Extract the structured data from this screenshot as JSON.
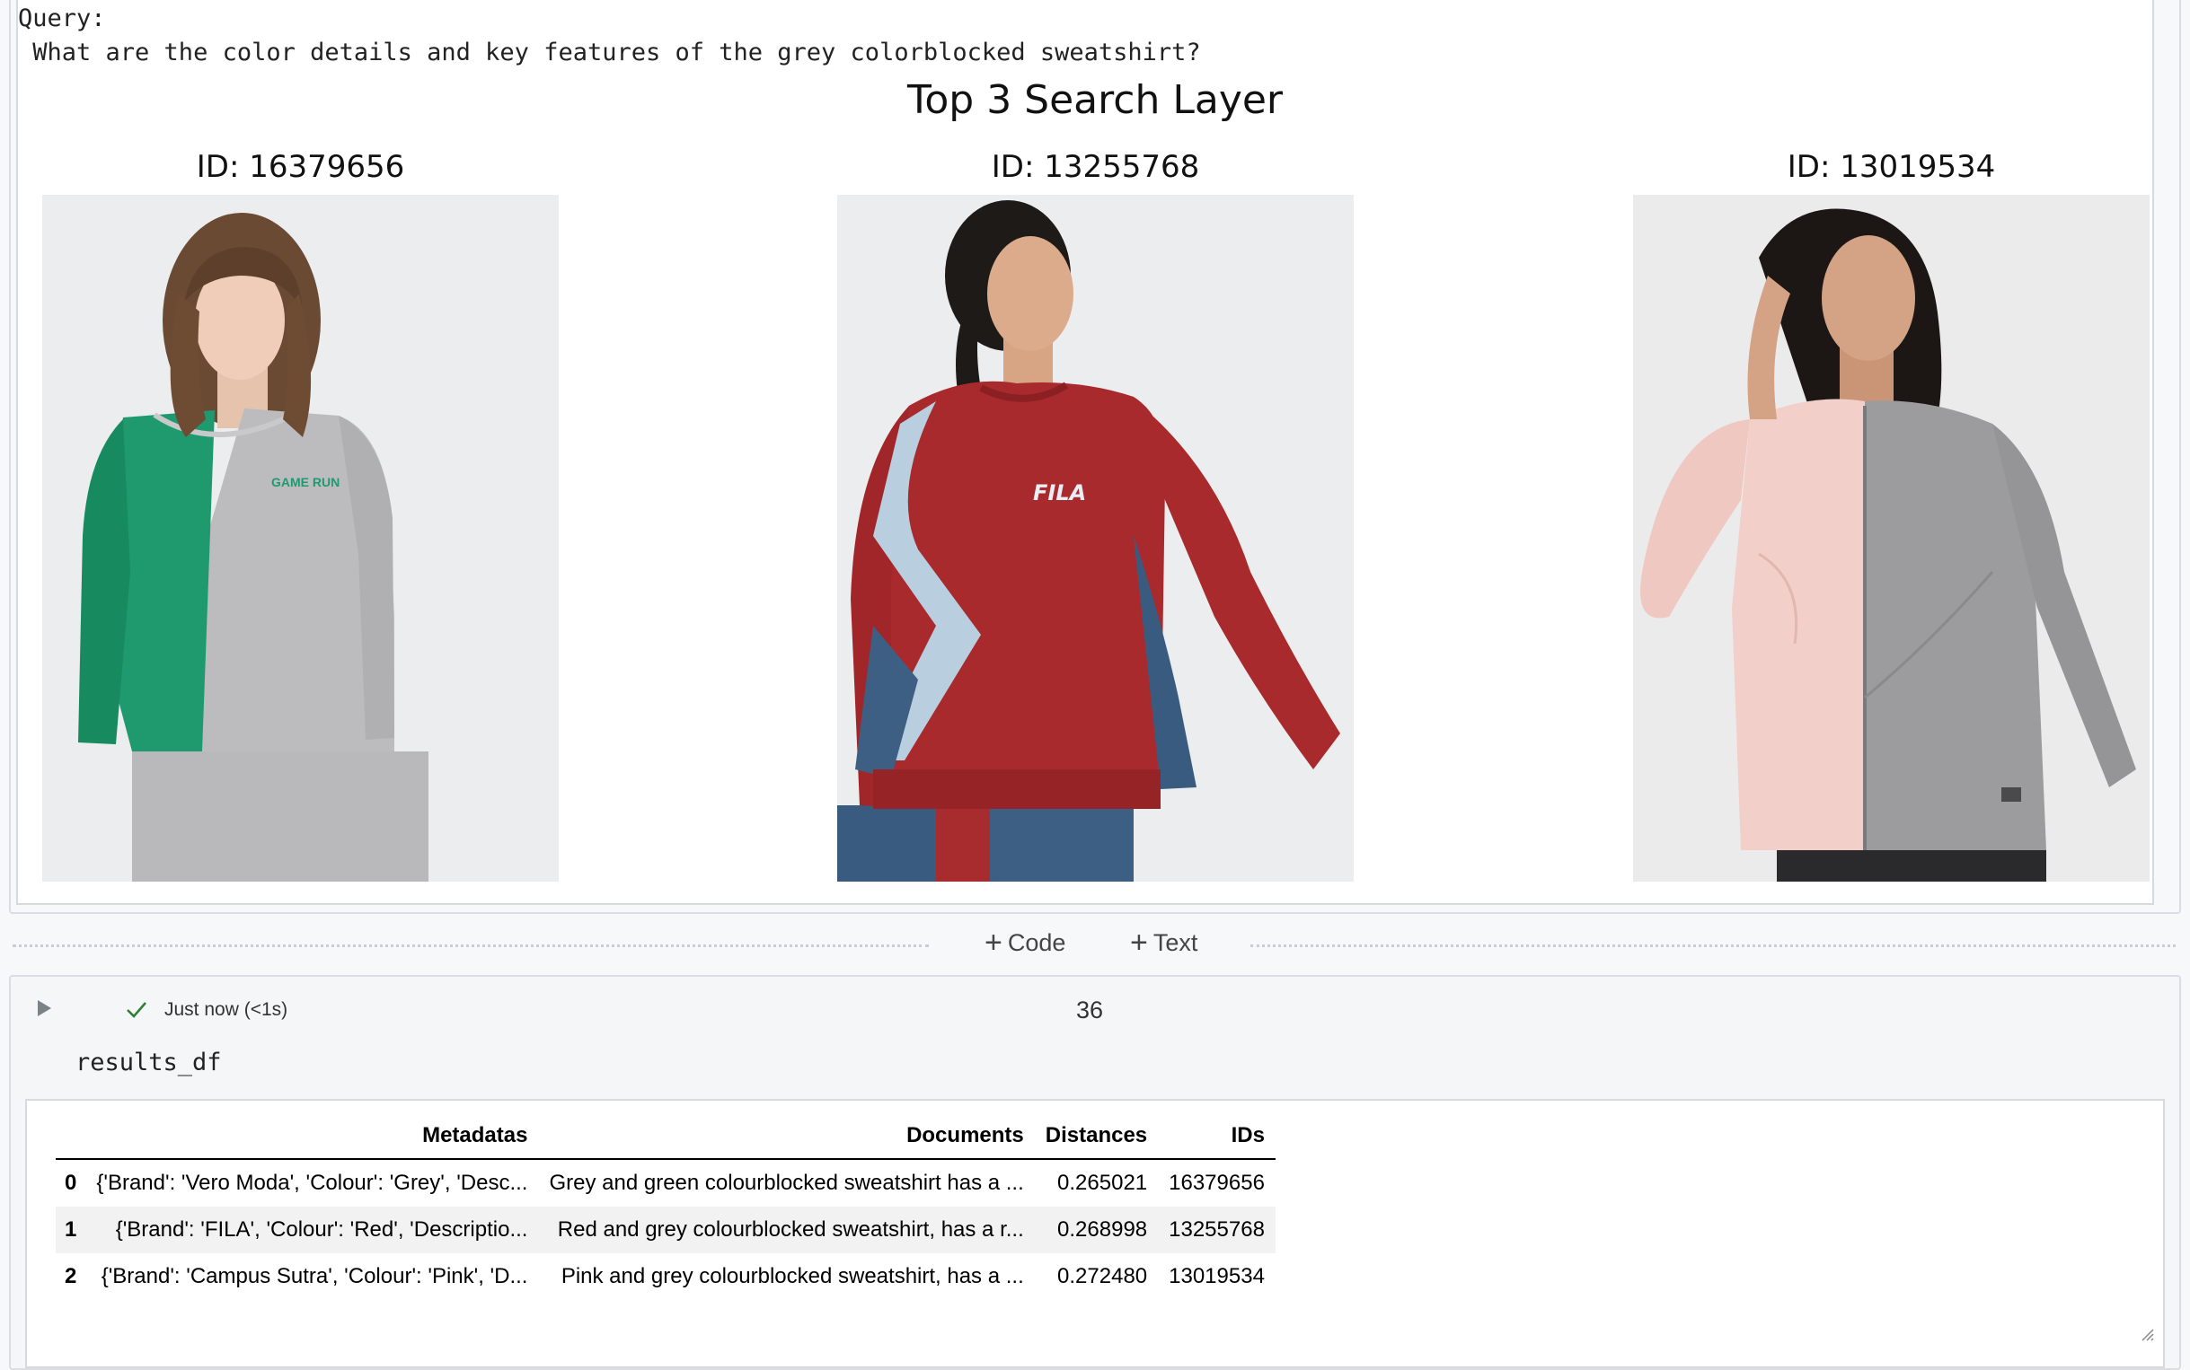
{
  "output": {
    "query_label": "Query:",
    "query_text": " What are the color details and key features of the grey colorblocked sweatshirt?",
    "plot_title": "Top 3 Search Layer",
    "images": [
      {
        "title": "ID: 16379656",
        "desc": "woman in green and grey colourblocked sweatshirt"
      },
      {
        "title": "ID: 13255768",
        "desc": "woman in red FILA colourblocked sweatshirt",
        "logo_text": "FILA"
      },
      {
        "title": "ID: 13019534",
        "desc": "woman in pink and grey colourblocked zip jacket"
      }
    ]
  },
  "add_bar": {
    "code_label": "Code",
    "text_label": "Text"
  },
  "code_cell": {
    "status": "Just now (<1s)",
    "execution_count": "36",
    "code": "results_df"
  },
  "dataframe": {
    "columns": [
      "",
      "Metadatas",
      "Documents",
      "Distances",
      "IDs"
    ],
    "rows": [
      {
        "index": "0",
        "metadatas": "{'Brand': 'Vero Moda', 'Colour': 'Grey', 'Desc...",
        "documents": "Grey and green colourblocked sweatshirt has a ...",
        "distances": "0.265021",
        "ids": "16379656"
      },
      {
        "index": "1",
        "metadatas": "{'Brand': 'FILA', 'Colour': 'Red', 'Descriptio...",
        "documents": "Red and grey colourblocked sweatshirt, has a r...",
        "distances": "0.268998",
        "ids": "13255768"
      },
      {
        "index": "2",
        "metadatas": "{'Brand': 'Campus Sutra', 'Colour': 'Pink', 'D...",
        "documents": "Pink and grey colourblocked sweatshirt, has a ...",
        "distances": "0.272480",
        "ids": "13019534"
      }
    ]
  },
  "colors": {
    "accent_check": "#2e7d32",
    "cell_border": "#dadde1"
  }
}
